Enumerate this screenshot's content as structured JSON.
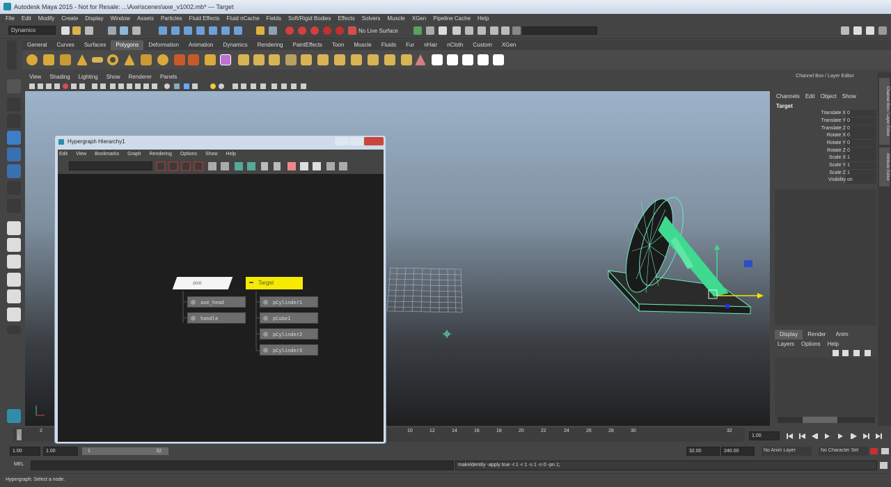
{
  "window": {
    "title": "Autodesk Maya 2015 - Not for Resale: ...\\Axe\\scenes\\axe_v1002.mb*   ---   Target"
  },
  "main_menu": [
    "File",
    "Edit",
    "Modify",
    "Create",
    "Display",
    "Window",
    "Assets",
    "Particles",
    "Fluid Effects",
    "Fluid nCache",
    "Fields",
    "Soft/Rigid Bodies",
    "Effects",
    "Solvers",
    "Muscle",
    "XGen",
    "Pipeline Cache",
    "Help"
  ],
  "status_line": {
    "menu_set": "Dynamics",
    "live_surface": "No Live Surface"
  },
  "shelf_tabs": [
    "General",
    "Curves",
    "Surfaces",
    "Polygons",
    "Deformation",
    "Animation",
    "Dynamics",
    "Rendering",
    "PaintEffects",
    "Toon",
    "Muscle",
    "Fluids",
    "Fur",
    "nHair",
    "nCloth",
    "Custom",
    "XGen"
  ],
  "shelf_active_tab": "Polygons",
  "panel_menu": [
    "View",
    "Shading",
    "Lighting",
    "Show",
    "Renderer",
    "Panels"
  ],
  "channel_box": {
    "title": "Channel Box / Layer Editor",
    "menu": [
      "Channels",
      "Edit",
      "Object",
      "Show"
    ],
    "object": "Target",
    "channels": [
      {
        "label": "Translate X",
        "value": "0"
      },
      {
        "label": "Translate Y",
        "value": "0"
      },
      {
        "label": "Translate Z",
        "value": "0"
      },
      {
        "label": "Rotate X",
        "value": "0"
      },
      {
        "label": "Rotate Y",
        "value": "0"
      },
      {
        "label": "Rotate Z",
        "value": "0"
      },
      {
        "label": "Scale X",
        "value": "1"
      },
      {
        "label": "Scale Y",
        "value": "1"
      },
      {
        "label": "Scale Z",
        "value": "1"
      },
      {
        "label": "Visibility",
        "value": "on"
      }
    ]
  },
  "side_tabs": [
    "Channel Box / Layer Editor",
    "Attribute Editor"
  ],
  "layer_editor": {
    "tabs": [
      "Display",
      "Render",
      "Anim"
    ],
    "active": "Display",
    "menu": [
      "Layers",
      "Options",
      "Help"
    ]
  },
  "hypergraph": {
    "title": "Hypergraph Hierarchy1",
    "menu": [
      "Edit",
      "View",
      "Bookmarks",
      "Graph",
      "Rendering",
      "Options",
      "Show",
      "Help"
    ],
    "nodes": {
      "axe": "axe",
      "axe_children": [
        "axe_head",
        "handle"
      ],
      "target": "Target",
      "target_children": [
        "pCylinder1",
        "pCube1",
        "pCylinder2",
        "pCylinder3"
      ]
    }
  },
  "time_slider": {
    "ticks": [
      "1",
      "2",
      "4",
      "6",
      "8",
      "10",
      "12",
      "14",
      "16",
      "18",
      "20",
      "22",
      "24",
      "26",
      "28",
      "30",
      "32"
    ],
    "current": "1.00"
  },
  "range_slider": {
    "start": "1.00",
    "start_inner": "1.00",
    "range_start": "1",
    "range_end": "32",
    "end_inner": "32.00",
    "end": "240.00",
    "anim_layer": "No Anim Layer",
    "char_set": "No Character Set"
  },
  "command_line": {
    "label": "MEL",
    "result": "makeIdentity -apply true -t 1 -r 1 -s 1 -n 0 -pn 1;"
  },
  "help_line": "Hypergraph: Select a node.",
  "colors": {
    "accent_polygons": "#5c5c5c",
    "target_node": "#f5ea00",
    "wireframe": "#5fe6b0",
    "selection": "#3fd98f"
  }
}
